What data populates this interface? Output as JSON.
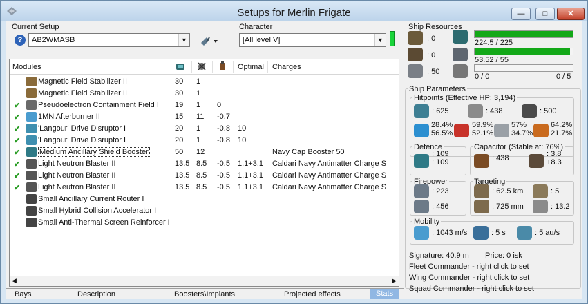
{
  "window": {
    "title": "Setups for Merlin Frigate",
    "min": "—",
    "max": "□",
    "close": "✕"
  },
  "current_setup": {
    "label": "Current Setup",
    "value": "AB2WMASB"
  },
  "character": {
    "label": "Character",
    "value": "[All level V]"
  },
  "modules": {
    "headers": {
      "modules": "Modules",
      "optimal": "Optimal",
      "charges": "Charges"
    },
    "rows": [
      {
        "checked": false,
        "name": "Magnetic Field Stabilizer II",
        "c1": "30",
        "c2": "1",
        "c3": "",
        "optimal": "",
        "charges": "",
        "icon_color": "#8a6b3a"
      },
      {
        "checked": false,
        "name": "Magnetic Field Stabilizer II",
        "c1": "30",
        "c2": "1",
        "c3": "",
        "optimal": "",
        "charges": "",
        "icon_color": "#8a6b3a"
      },
      {
        "checked": true,
        "name": "Pseudoelectron Containment Field I",
        "c1": "19",
        "c2": "1",
        "c3": "0",
        "optimal": "",
        "charges": "",
        "icon_color": "#6a6a6a"
      },
      {
        "checked": true,
        "name": "1MN Afterburner II",
        "c1": "15",
        "c2": "11",
        "c3": "-0.7",
        "optimal": "",
        "charges": "",
        "icon_color": "#4a9ccf"
      },
      {
        "checked": true,
        "name": "'Langour' Drive Disruptor I",
        "c1": "20",
        "c2": "1",
        "c3": "-0.8",
        "optimal": "10",
        "charges": "",
        "icon_color": "#3e8fb0"
      },
      {
        "checked": true,
        "name": "'Langour' Drive Disruptor I",
        "c1": "20",
        "c2": "1",
        "c3": "-0.8",
        "optimal": "10",
        "charges": "",
        "icon_color": "#3e8fb0"
      },
      {
        "checked": true,
        "name": "Medium Ancillary Shield Booster",
        "c1": "50",
        "c2": "12",
        "c3": "",
        "optimal": "",
        "charges": "Navy Cap Booster 50",
        "icon_color": "#2f7a86",
        "selected": true
      },
      {
        "checked": true,
        "name": "Light Neutron Blaster II",
        "c1": "13.5",
        "c2": "8.5",
        "c3": "-0.5",
        "optimal": "1.1+3.1",
        "charges": "Caldari Navy Antimatter Charge S",
        "icon_color": "#555"
      },
      {
        "checked": true,
        "name": "Light Neutron Blaster II",
        "c1": "13.5",
        "c2": "8.5",
        "c3": "-0.5",
        "optimal": "1.1+3.1",
        "charges": "Caldari Navy Antimatter Charge S",
        "icon_color": "#555"
      },
      {
        "checked": true,
        "name": "Light Neutron Blaster II",
        "c1": "13.5",
        "c2": "8.5",
        "c3": "-0.5",
        "optimal": "1.1+3.1",
        "charges": "Caldari Navy Antimatter Charge S",
        "icon_color": "#555"
      },
      {
        "checked": false,
        "name": "Small Ancillary Current Router I",
        "c1": "",
        "c2": "",
        "c3": "",
        "optimal": "",
        "charges": "",
        "icon_color": "#444"
      },
      {
        "checked": false,
        "name": "Small Hybrid Collision Accelerator I",
        "c1": "",
        "c2": "",
        "c3": "",
        "optimal": "",
        "charges": "",
        "icon_color": "#444"
      },
      {
        "checked": false,
        "name": "Small Anti-Thermal Screen Reinforcer I",
        "c1": "",
        "c2": "",
        "c3": "",
        "optimal": "",
        "charges": "",
        "icon_color": "#444"
      }
    ]
  },
  "tabs": [
    "Bays",
    "Description",
    "Boosters\\Implants",
    "Projected effects",
    "Stats"
  ],
  "resources": {
    "label": "Ship Resources",
    "turrets": ": 0",
    "launchers": ": 0",
    "drone_bay": ": 50",
    "cpu_text": "224.5 / 225",
    "cpu_fraction": 0.998,
    "power_text": "53.52 / 55",
    "power_fraction": 0.973,
    "drones_text": "0 / 0",
    "drones_active": "0 / 5"
  },
  "parameters": {
    "label": "Ship Parameters",
    "hitpoints_label": "Hitpoints (Effective HP: 3,194)",
    "shield_hp": ": 625",
    "armor_hp": ": 438",
    "hull_hp": ": 500",
    "res": [
      {
        "a": "28.4%",
        "b": "56.5%"
      },
      {
        "a": "59.9%",
        "b": "52.1%"
      },
      {
        "a": "57%",
        "b": "34.7%"
      },
      {
        "a": "64.2%",
        "b": "21.7%"
      }
    ],
    "defence_label": "Defence",
    "defence_a": ": 109",
    "defence_b": ": 109",
    "capacitor_label": "Capacitor (Stable at: 76%)",
    "cap_amount": ": 438",
    "cap_a": ": 3.8",
    "cap_b": "+8.3",
    "firepower_label": "Firepower",
    "fp_a": ": 223",
    "fp_b": ": 456",
    "targeting_label": "Targeting",
    "tg_range": ": 62.5 km",
    "tg_targets": ": 5",
    "tg_res": ": 725 mm",
    "tg_sig": ": 13.2",
    "mobility_label": "Mobility",
    "speed": ": 1043 m/s",
    "align": ": 5 s",
    "warp": ": 5 au/s",
    "signature": "Signature: 40.9 m",
    "price": "Price: 0 isk",
    "fleet": "Fleet Commander - right click to set",
    "wing": "Wing Commander - right click to set",
    "squad": "Squad Commander - right click to set"
  }
}
